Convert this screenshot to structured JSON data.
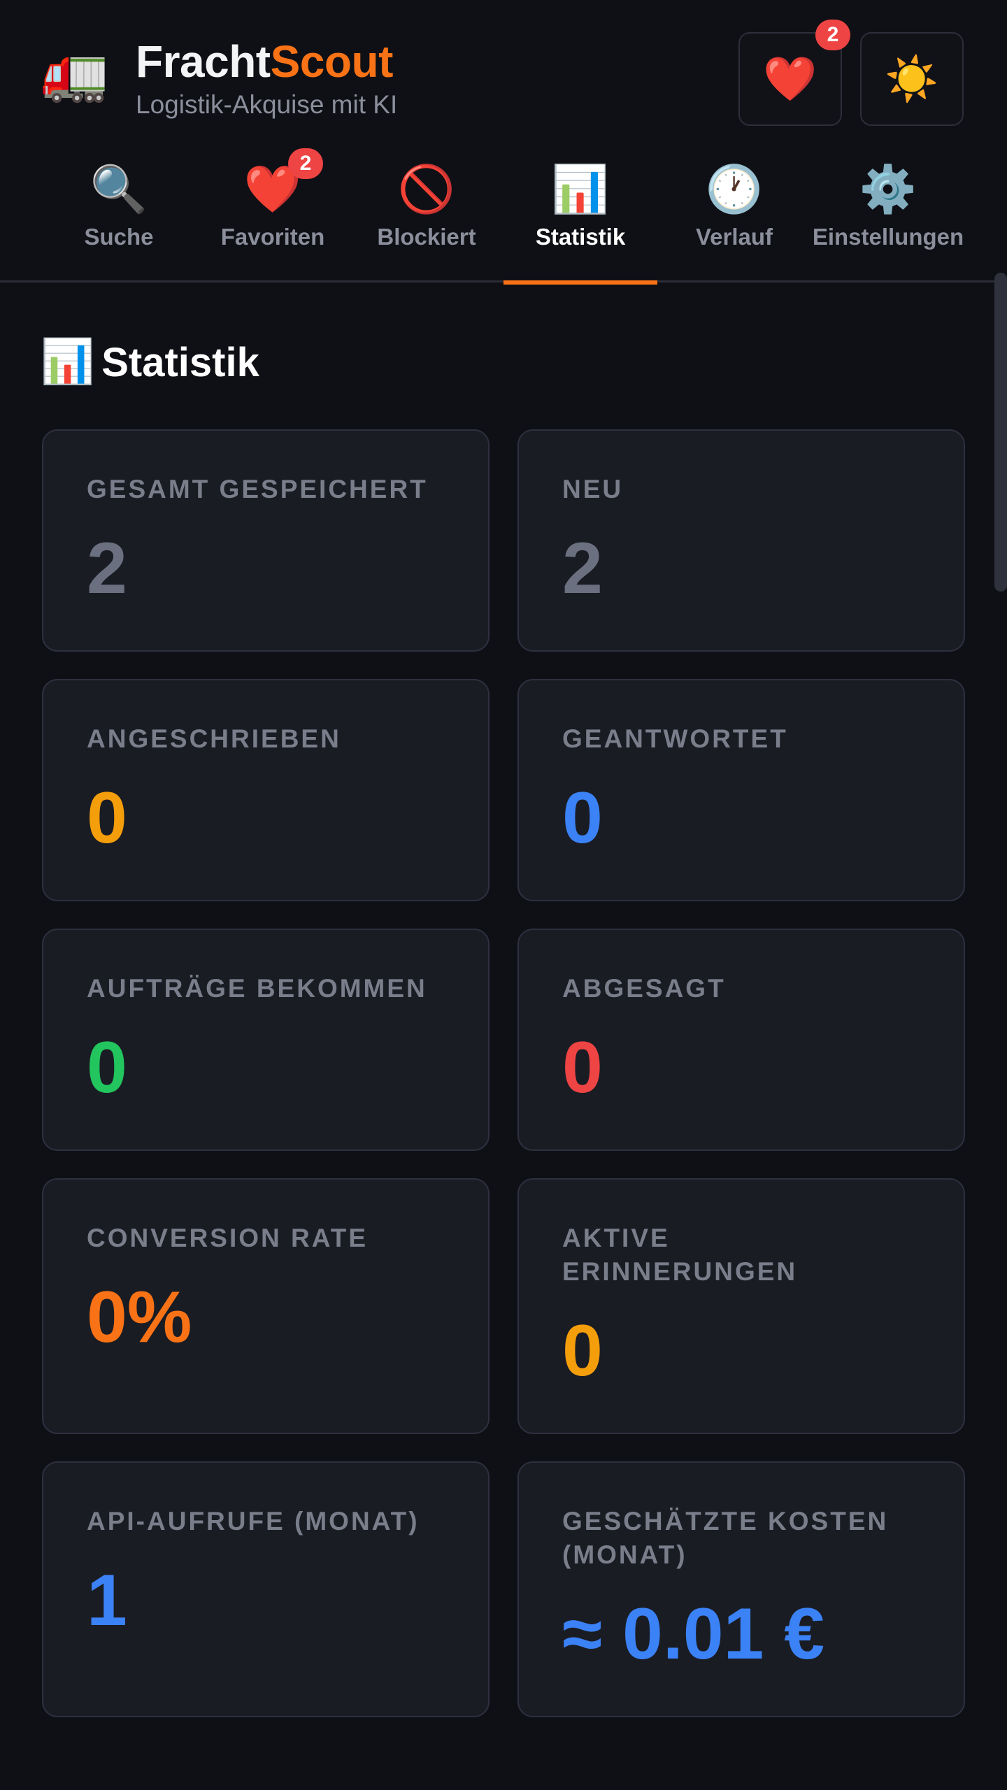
{
  "header": {
    "logo_icon": "🚛",
    "brand_part1": "Fracht",
    "brand_part2": "Scout",
    "tagline": "Logistik-Akquise mit KI",
    "favorites_button_icon": "❤️",
    "favorites_badge": "2",
    "theme_button_icon": "☀️"
  },
  "tabs": [
    {
      "icon": "🔍",
      "label": "Suche"
    },
    {
      "icon": "❤️",
      "label": "Favoriten",
      "badge": "2"
    },
    {
      "icon": "🚫",
      "label": "Blockiert"
    },
    {
      "icon": "📊",
      "label": "Statistik",
      "active": true
    },
    {
      "icon": "🕐",
      "label": "Verlauf"
    },
    {
      "icon": "⚙️",
      "label": "Einstellungen"
    }
  ],
  "section": {
    "icon": "📊",
    "title": "Statistik"
  },
  "stats": [
    {
      "label": "GESAMT GESPEICHERT",
      "value": "2",
      "color": "#6b7080"
    },
    {
      "label": "NEU",
      "value": "2",
      "color": "#6b7080"
    },
    {
      "label": "ANGESCHRIEBEN",
      "value": "0",
      "color": "#f59e0b"
    },
    {
      "label": "GEANTWORTET",
      "value": "0",
      "color": "#3b82f6"
    },
    {
      "label": "AUFTRÄGE BEKOMMEN",
      "value": "0",
      "color": "#22c55e"
    },
    {
      "label": "ABGESAGT",
      "value": "0",
      "color": "#ef4444"
    },
    {
      "label": "CONVERSION RATE",
      "value": "0%",
      "color": "#f97316"
    },
    {
      "label": "AKTIVE ERINNERUNGEN",
      "value": "0",
      "color": "#f59e0b"
    },
    {
      "label": "API-AUFRUFE (MONAT)",
      "value": "1",
      "color": "#3b82f6"
    },
    {
      "label": "GESCHÄTZTE KOSTEN (MONAT)",
      "value": "≈ 0.01 €",
      "color": "#3b82f6"
    }
  ],
  "colors": {
    "accent": "#f97316",
    "background": "#0f1015",
    "card": "#1a1c24"
  }
}
